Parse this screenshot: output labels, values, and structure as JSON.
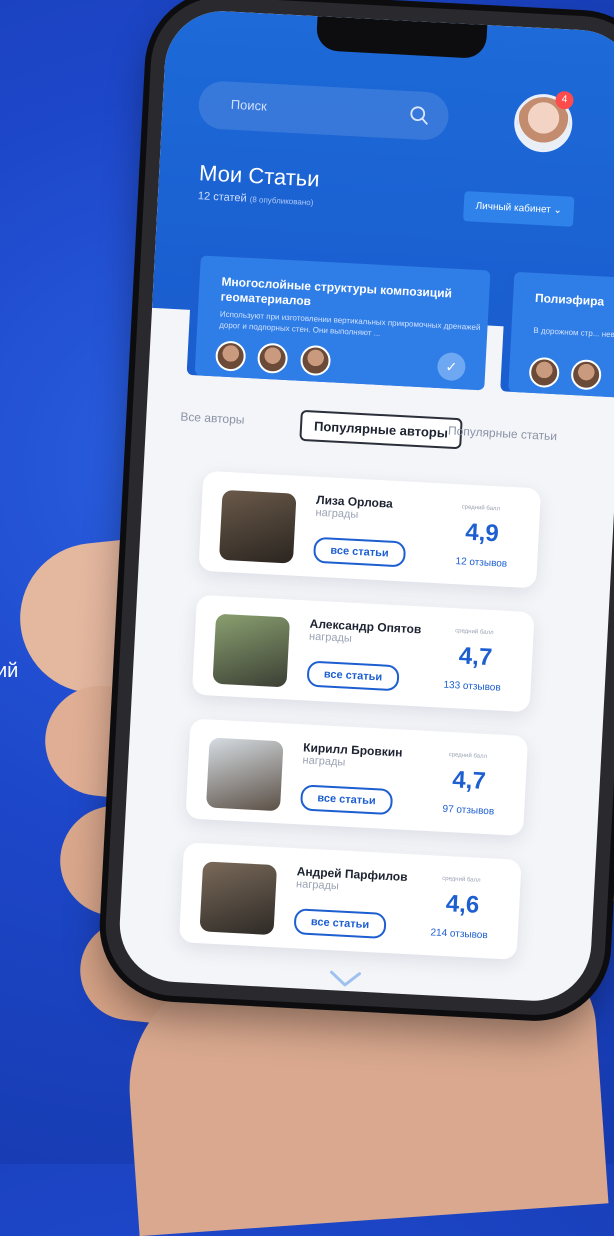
{
  "background": {
    "partial_text": "ий"
  },
  "app": {
    "search": {
      "placeholder": "Поиск"
    },
    "profile": {
      "notification_count": "4"
    },
    "header": {
      "title": "Мои Статьи",
      "subtitle_main": "12 статей",
      "subtitle_small": "(8 опубликовано)",
      "cabinet_button": "Личный кабинет ⌄"
    },
    "cards": [
      {
        "title": "Многослойные структуры композиций геоматериалов",
        "description": "Используют при изготовлении вертикальных прикромочных дренажей дорог и подпорных стен. Они выполняют ...",
        "avatar_count": 3
      },
      {
        "title": "Полиэфира",
        "description": "В дорожном стр... невой системы д...",
        "avatar_count": 2
      }
    ],
    "tabs": [
      {
        "label": "Все авторы"
      },
      {
        "label": "Популярные авторы"
      },
      {
        "label": "Популярные статьи"
      }
    ],
    "authors": [
      {
        "name": "Лиза Орлова",
        "awards": "награды",
        "button": "все статьи",
        "rating_label": "средний балл",
        "rating": "4,9",
        "reviews": "12 отзывов"
      },
      {
        "name": "Александр Опятов",
        "awards": "награды",
        "button": "все статьи",
        "rating_label": "средний балл",
        "rating": "4,7",
        "reviews": "133 отзывов"
      },
      {
        "name": "Кирилл Бровкин",
        "awards": "награды",
        "button": "все статьи",
        "rating_label": "средний балл",
        "rating": "4,7",
        "reviews": "97 отзывов"
      },
      {
        "name": "Андрей Парфилов",
        "awards": "награды",
        "button": "все статьи",
        "rating_label": "средний балл",
        "rating": "4,6",
        "reviews": "214 отзывов"
      }
    ],
    "colors": {
      "primary": "#1d5fd0",
      "header": "#1a5ed0",
      "badge": "#ff4b4b"
    }
  }
}
